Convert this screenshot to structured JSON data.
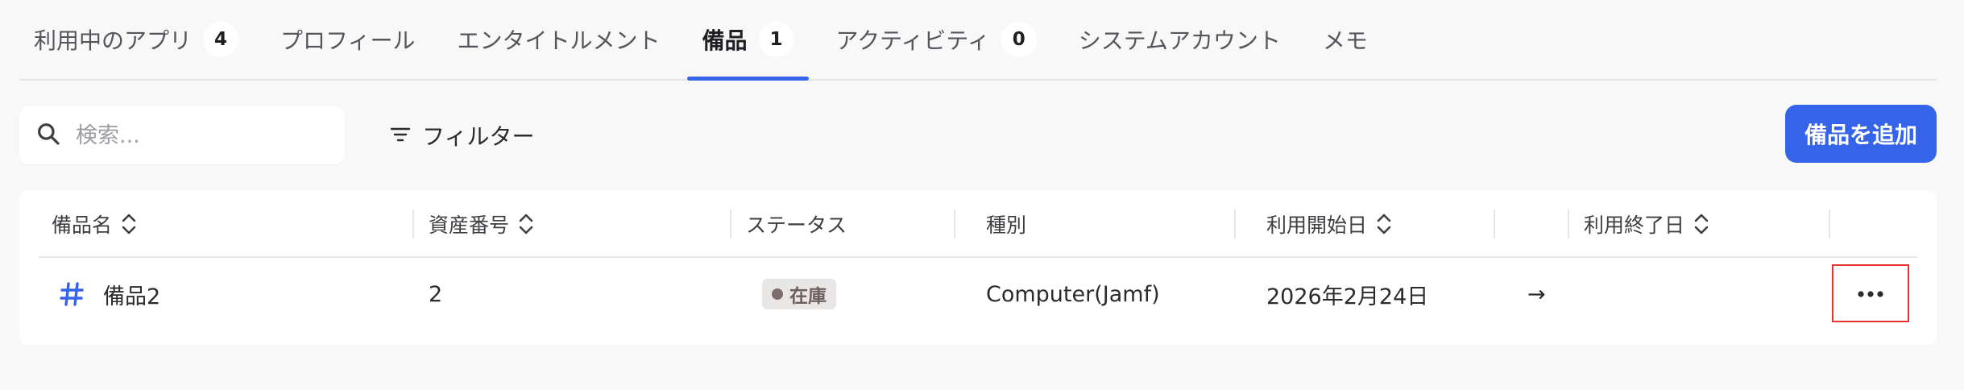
{
  "tabs": [
    {
      "label": "利用中のアプリ",
      "count": "4"
    },
    {
      "label": "プロフィール"
    },
    {
      "label": "エンタイトルメント"
    },
    {
      "label": "備品",
      "count": "1",
      "active": true
    },
    {
      "label": "アクティビティ",
      "count": "0"
    },
    {
      "label": "システムアカウント"
    },
    {
      "label": "メモ"
    }
  ],
  "toolbar": {
    "search_placeholder": "検索...",
    "filter_label": "フィルター",
    "add_label": "備品を追加"
  },
  "table": {
    "columns": [
      "備品名",
      "資産番号",
      "ステータス",
      "種別",
      "利用開始日",
      "利用終了日"
    ],
    "rows": [
      {
        "name": "備品2",
        "asset_number": "2",
        "status": "在庫",
        "type": "Computer(Jamf)",
        "start_date": "2026年2月24日",
        "arrow": "→",
        "end_date": ""
      }
    ]
  },
  "colors": {
    "accent": "#3563e9",
    "highlight_border": "#e3352d",
    "status_badge_bg": "#e9e6e6",
    "status_dot": "#7d6d6d"
  },
  "icons": {
    "search": "search-icon",
    "filter": "filter-icon",
    "sort": "sort-icon",
    "item": "hash-icon",
    "arrow": "arrow-right-icon",
    "more": "more-horizontal-icon"
  }
}
